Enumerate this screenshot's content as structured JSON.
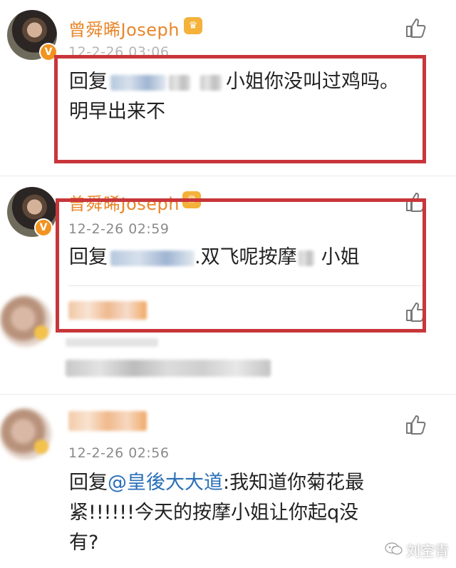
{
  "comments": [
    {
      "username": "曾舜晞Joseph",
      "timestamp": "12-2-26 03:06",
      "reply_prefix": "回复",
      "text_line1_suffix": "小姐你没叫过鸡吗。",
      "text_line2": "明早出来不"
    },
    {
      "username": "曾舜晞Joseph",
      "timestamp": "12-2-26 02:59",
      "reply_prefix": "回复",
      "text_mid": ".双飞呢按摩",
      "text_end": "小姐"
    },
    {
      "timestamp": "12-2-26 02:56",
      "reply_prefix": "回复",
      "mention": "@皇後大大道",
      "text_after_mention": ":我知道你菊花最",
      "text_line2": "紧!!!!!!今天的按摩小姐让你起q没",
      "text_line3": "有?"
    }
  ],
  "watermark": {
    "text": "刘空青",
    "icon": "wechat-icon"
  },
  "icons": {
    "like": "thumbs-up-icon",
    "verify": "verified-badge-icon",
    "crown": "crown-badge-icon"
  },
  "colors": {
    "username": "#e8862a",
    "highlight_box": "#c8363a",
    "mention": "#2a6fb8",
    "timestamp": "#8a8a8a"
  }
}
